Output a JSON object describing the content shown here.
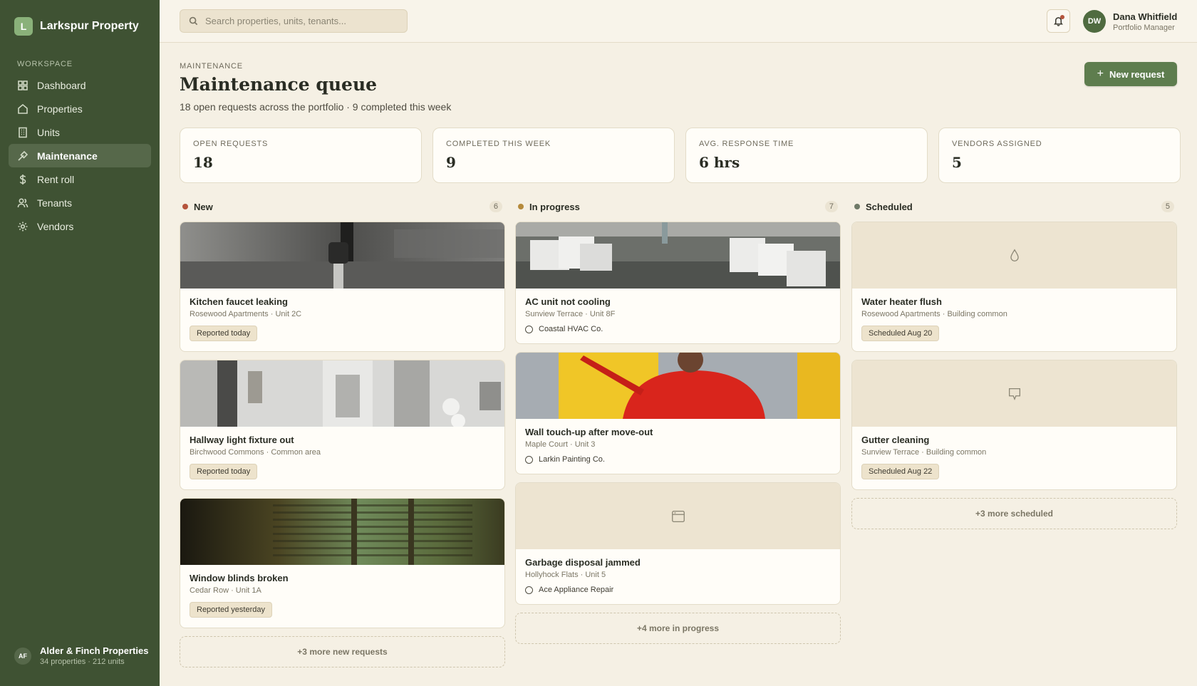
{
  "brand": {
    "initial": "L",
    "name": "Larkspur Property"
  },
  "sidebar": {
    "heading": "WORKSPACE",
    "items": [
      {
        "label": "Dashboard",
        "icon": "grid-icon"
      },
      {
        "label": "Properties",
        "icon": "home-icon"
      },
      {
        "label": "Units",
        "icon": "building-icon"
      },
      {
        "label": "Maintenance",
        "icon": "wrench-icon",
        "active": true
      },
      {
        "label": "Rent roll",
        "icon": "dollar-icon"
      },
      {
        "label": "Tenants",
        "icon": "users-icon"
      },
      {
        "label": "Vendors",
        "icon": "gear-icon"
      }
    ],
    "org": {
      "initials": "AF",
      "name": "Alder & Finch Properties",
      "sub": "34 properties · 212 units"
    }
  },
  "topbar": {
    "search_placeholder": "Search properties, units, tenants...",
    "user": {
      "initials": "DW",
      "name": "Dana Whitfield",
      "role": "Portfolio Manager"
    }
  },
  "header": {
    "eyebrow": "MAINTENANCE",
    "title": "Maintenance queue",
    "subtitle": "18 open requests across the portfolio · 9 completed this week",
    "new_button": "New request"
  },
  "stats": [
    {
      "label": "OPEN REQUESTS",
      "value": "18"
    },
    {
      "label": "COMPLETED THIS WEEK",
      "value": "9"
    },
    {
      "label": "AVG. RESPONSE TIME",
      "value": "6 hrs"
    },
    {
      "label": "VENDORS ASSIGNED",
      "value": "5"
    }
  ],
  "columns": [
    {
      "title": "New",
      "count": "6",
      "color": "#b5543c",
      "cards": [
        {
          "title": "Kitchen faucet leaking",
          "meta": "Rosewood Apartments · Unit 2C",
          "badge": "Reported today"
        },
        {
          "title": "Hallway light fixture out",
          "meta": "Birchwood Commons · Common area",
          "badge": "Reported today"
        },
        {
          "title": "Window blinds broken",
          "meta": "Cedar Row · Unit 1A",
          "badge": "Reported yesterday"
        }
      ],
      "more": "+3 more new requests"
    },
    {
      "title": "In progress",
      "count": "7",
      "color": "#b58a3c",
      "cards": [
        {
          "title": "AC unit not cooling",
          "meta": "Sunview Terrace · Unit 8F",
          "vendor": "Coastal HVAC Co."
        },
        {
          "title": "Wall touch-up after move-out",
          "meta": "Maple Court · Unit 3",
          "vendor": "Larkin Painting Co."
        },
        {
          "title": "Garbage disposal jammed",
          "meta": "Hollyhock Flats · Unit 5",
          "vendor": "Ace Appliance Repair"
        }
      ],
      "more": "+4 more in progress"
    },
    {
      "title": "Scheduled",
      "count": "5",
      "color": "#6f7a68",
      "cards": [
        {
          "title": "Water heater flush",
          "meta": "Rosewood Apartments · Building common",
          "badge": "Scheduled Aug 20"
        },
        {
          "title": "Gutter cleaning",
          "meta": "Sunview Terrace · Building common",
          "badge": "Scheduled Aug 22"
        }
      ],
      "more": "+3 more scheduled"
    }
  ]
}
